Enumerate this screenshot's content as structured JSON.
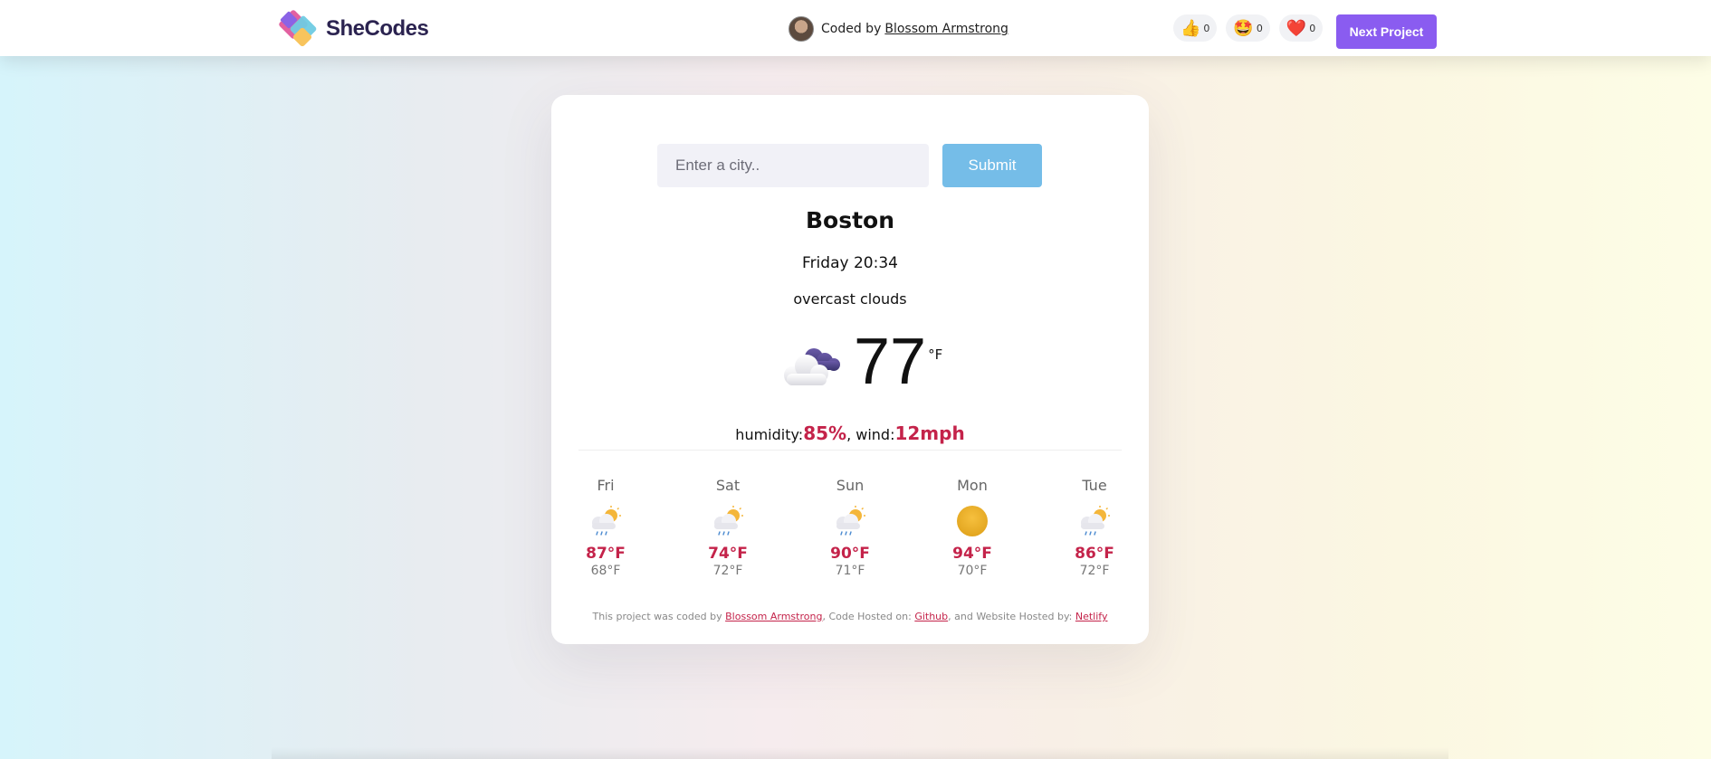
{
  "navbar": {
    "logo_text": "SheCodes",
    "coded_by_prefix": "Coded by",
    "author_name": "Blossom Armstrong",
    "reactions": [
      {
        "icon": "thumbs-up-icon",
        "emoji": "👍",
        "count": "0"
      },
      {
        "icon": "star-struck-icon",
        "emoji": "🤩",
        "count": "0"
      },
      {
        "icon": "heart-icon",
        "emoji": "❤️",
        "count": "0"
      }
    ],
    "next_project_label": "Next Project"
  },
  "search": {
    "placeholder": "Enter a city..",
    "value": "",
    "submit_label": "Submit"
  },
  "weather": {
    "city": "Boston",
    "datetime": "Friday 20:34",
    "description": "overcast clouds",
    "icon": "cloud-icon",
    "temperature": "77",
    "unit": "°F",
    "humidity_label": "humidity:",
    "humidity_value": "85%",
    "wind_label": ", wind:",
    "wind_value": "12mph"
  },
  "forecast": [
    {
      "day": "Fri",
      "icon": "rain-sun-icon",
      "max": "87°F",
      "min": "68°F"
    },
    {
      "day": "Sat",
      "icon": "rain-sun-icon",
      "max": "74°F",
      "min": "72°F"
    },
    {
      "day": "Sun",
      "icon": "rain-sun-icon",
      "max": "90°F",
      "min": "71°F"
    },
    {
      "day": "Mon",
      "icon": "sun-icon",
      "max": "94°F",
      "min": "70°F"
    },
    {
      "day": "Tue",
      "icon": "rain-sun-icon",
      "max": "86°F",
      "min": "72°F"
    }
  ],
  "footer": {
    "text1": "This project was coded by ",
    "author_link": "Blossom Armstrong",
    "text2": ", Code Hosted on: ",
    "github_link": "Github",
    "text3": ", and Website Hosted by: ",
    "netlify_link": "Netlify"
  },
  "colors": {
    "accent": "#c4234a",
    "button_purple": "#8a5cf0",
    "submit_blue": "#75bde8"
  }
}
